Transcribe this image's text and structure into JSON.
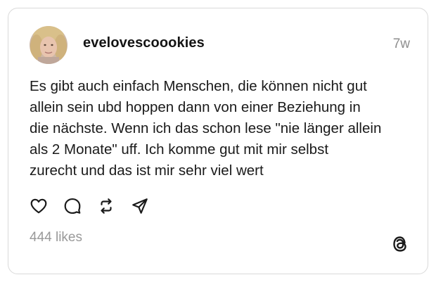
{
  "post": {
    "username": "evelovescoookies",
    "timestamp": "7w",
    "text": "Es gibt auch einfach Menschen,  die können nicht gut\nallein sein ubd hoppen dann von einer Beziehung in\ndie nächste. Wenn ich das schon lese \"nie länger allein\nals 2 Monate\" uff. Ich komme gut mit mir selbst\nzurecht und das ist mir sehr viel wert",
    "likes": "444 likes"
  },
  "actions": {
    "like_icon": "heart-icon",
    "comment_icon": "comment-icon",
    "repost_icon": "repost-icon",
    "share_icon": "send-icon"
  },
  "brand": {
    "logo_icon": "threads-logo-icon",
    "text_color": "#1a1a1a",
    "muted_color": "#8e8e8e",
    "border_color": "#d9d9d9"
  }
}
